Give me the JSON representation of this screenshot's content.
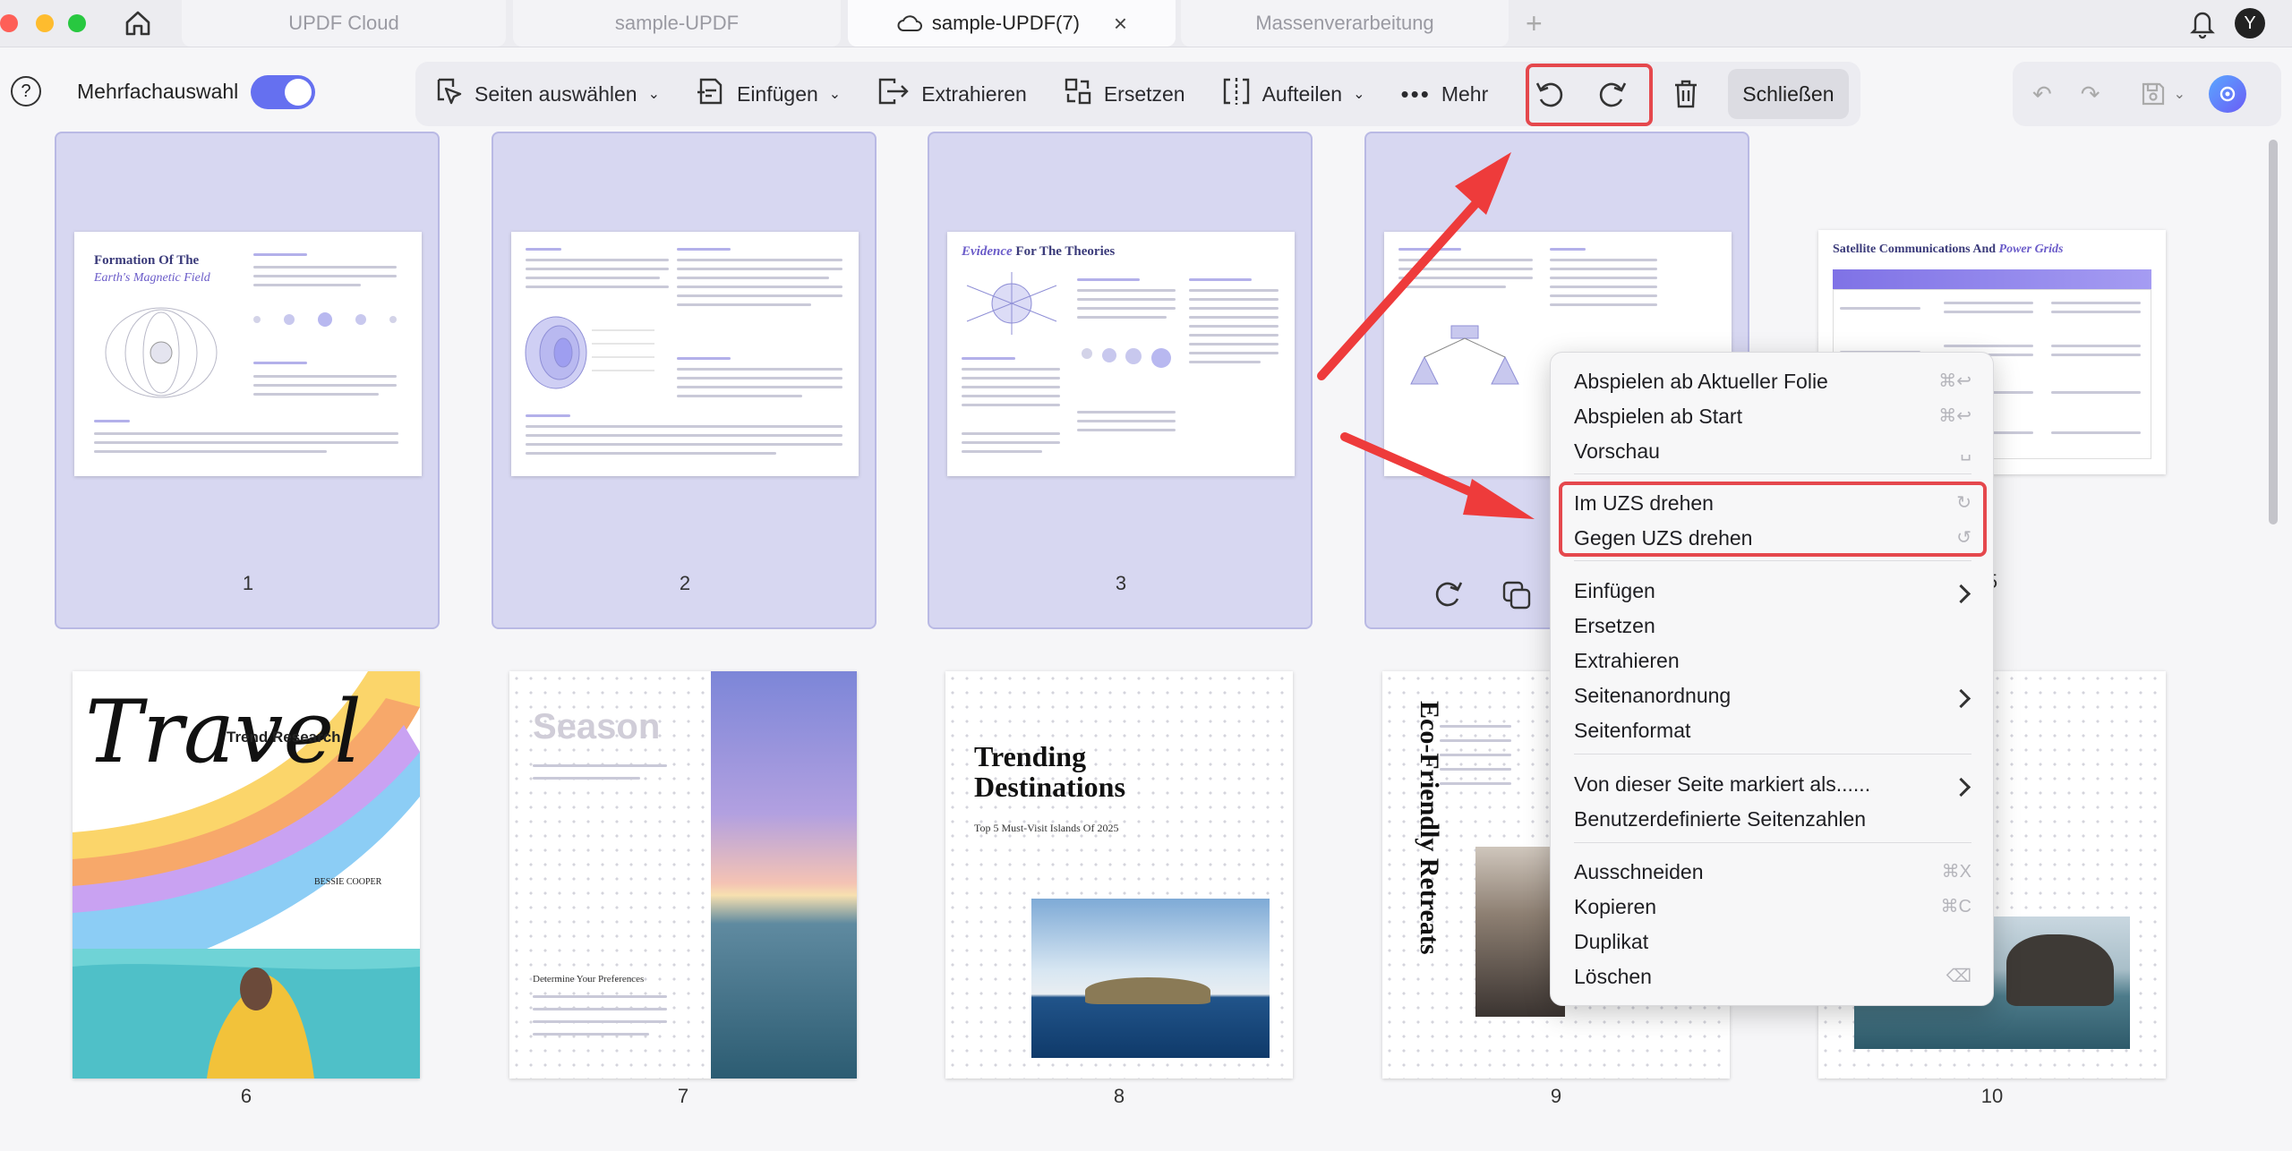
{
  "tabs": [
    {
      "label": "UPDF Cloud"
    },
    {
      "label": "sample-UPDF"
    },
    {
      "label": "sample-UPDF(7)"
    },
    {
      "label": "Massenverarbeitung"
    }
  ],
  "toolbar": {
    "multi_select_label": "Mehrfachauswahl",
    "multi_select_on": true,
    "select_pages": "Seiten auswählen",
    "insert": "Einfügen",
    "extract": "Extrahieren",
    "replace": "Ersetzen",
    "split": "Aufteilen",
    "more": "Mehr",
    "close": "Schließen"
  },
  "pages": [
    {
      "number": "1",
      "selected": true,
      "title1": "Formation Of The",
      "title2": "Earth's Magnetic Field"
    },
    {
      "number": "2",
      "selected": true
    },
    {
      "number": "3",
      "selected": true,
      "title1": "Evidence",
      "title2": "For The Theories"
    },
    {
      "number": "4",
      "selected": true
    },
    {
      "number": "5",
      "selected": false,
      "title1": "Satellite Communications And",
      "title2": "Power Grids"
    },
    {
      "number": "6",
      "selected": false,
      "title1": "Travel",
      "title2": "Trend Research",
      "author": "BESSIE COOPER"
    },
    {
      "number": "7",
      "selected": false,
      "title1": "Season",
      "subtitle": "Determine Your Preferences"
    },
    {
      "number": "8",
      "selected": false,
      "title1": "Trending",
      "title2": "Destinations",
      "subtitle": "Top 5 Must-Visit Islands Of 2025"
    },
    {
      "number": "9",
      "selected": false,
      "title1": "Eco-Friendly Retreats"
    },
    {
      "number": "10",
      "selected": false
    }
  ],
  "context_menu": {
    "items": [
      {
        "label": "Abspielen ab Aktueller Folie",
        "shortcut": "⌘↩"
      },
      {
        "label": "Abspielen ab Start",
        "shortcut": "⌘↩"
      },
      {
        "label": "Vorschau",
        "shortcut": "␣"
      },
      {
        "label": "Im UZS drehen",
        "shortcut": "↻"
      },
      {
        "label": "Gegen UZS drehen",
        "shortcut": "↺"
      },
      {
        "label": "Einfügen",
        "submenu": true
      },
      {
        "label": "Ersetzen"
      },
      {
        "label": "Extrahieren"
      },
      {
        "label": "Seitenanordnung",
        "submenu": true
      },
      {
        "label": "Seitenformat"
      },
      {
        "label": "Von dieser Seite markiert als......",
        "submenu": true
      },
      {
        "label": "Benutzerdefinierte Seitenzahlen"
      },
      {
        "label": "Ausschneiden",
        "shortcut": "⌘X"
      },
      {
        "label": "Kopieren",
        "shortcut": "⌘C"
      },
      {
        "label": "Duplikat"
      },
      {
        "label": "Löschen",
        "shortcut": "⌫"
      }
    ]
  },
  "avatar_letter": "Y",
  "colors": {
    "accent": "#6570f0",
    "selection": "#d7d7f1",
    "highlight": "#e5484d"
  }
}
